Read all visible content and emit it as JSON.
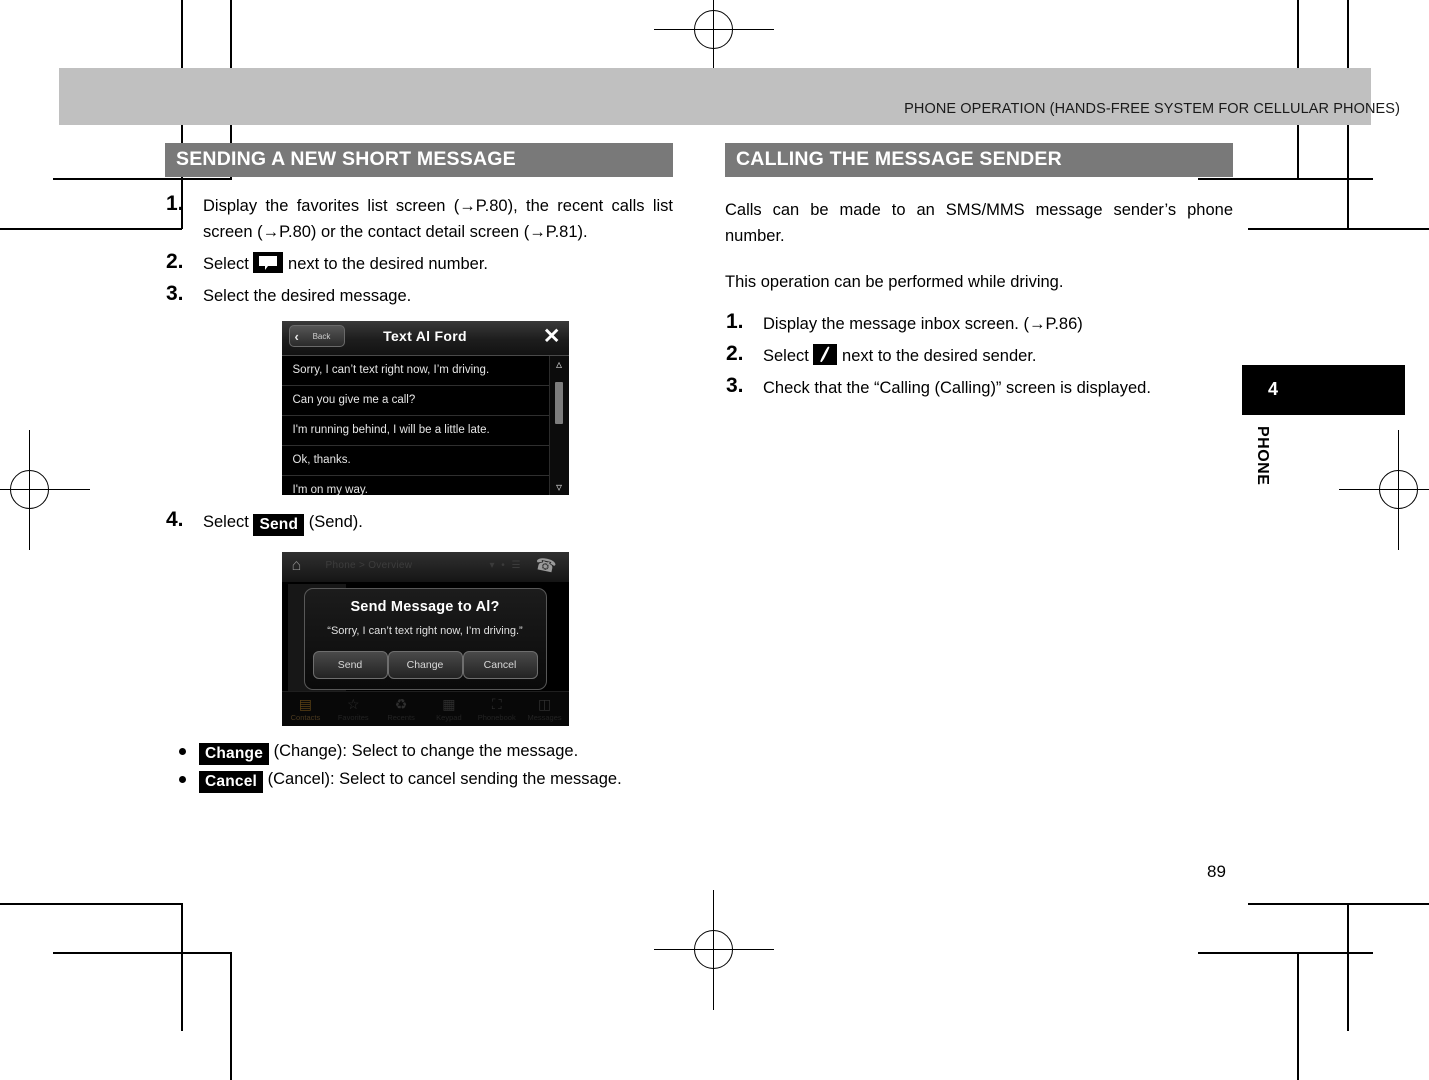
{
  "header": {
    "running_title": "PHONE OPERATION (HANDS-FREE SYSTEM FOR CELLULAR PHONES)"
  },
  "thumb_tab": {
    "chapter_number": "4",
    "chapter_label": "PHONE"
  },
  "page_number": "89",
  "left_column": {
    "section_title": "SENDING A NEW SHORT MESSAGE",
    "steps": [
      {
        "num": "1.",
        "text": "Display the favorites list screen (→P.80), the recent calls list screen (→P.80) or the contact detail screen (→P.81)."
      },
      {
        "num": "2.",
        "text_before": "Select",
        "icon": "message-bubble-icon",
        "text_after": "next to the desired number."
      },
      {
        "num": "3.",
        "text": "Select the desired message."
      },
      {
        "num": "4.",
        "text_before": "Select",
        "keycap": "Send",
        "text_after": "(Send)."
      }
    ],
    "message_list_screenshot": {
      "back_label": "Back",
      "title": "Text Al Ford",
      "close_icon": "close-icon",
      "messages": [
        "Sorry, I can’t text right now, I’m driving.",
        "Can you give me a call?",
        "I'm running behind, I will be a little late.",
        "Ok, thanks.",
        "I'm on my way."
      ],
      "scroll_up_icon": "chevron-up-icon",
      "scroll_down_icon": "chevron-down-icon"
    },
    "dialog_screenshot": {
      "home_icon": "home-icon",
      "breadcrumb": "Phone > Overview",
      "status_icons": "wifi-bluetooth-signal-icons",
      "handset_icon": "phone-handset-icon",
      "question": "Send Message to Al?",
      "body": "“Sorry, I can’t text right now, I’m driving.”",
      "buttons": [
        "Send",
        "Change",
        "Cancel"
      ],
      "tabs": [
        {
          "icon": "contacts-icon",
          "label": "Contacts"
        },
        {
          "icon": "star-icon",
          "label": "Favorites"
        },
        {
          "icon": "recents-icon",
          "label": "Recents"
        },
        {
          "icon": "keypad-icon",
          "label": "Keypad"
        },
        {
          "icon": "phonebook-icon",
          "label": "Phonebook"
        },
        {
          "icon": "messages-icon",
          "label": "Messages"
        }
      ]
    },
    "bullets": [
      {
        "keycap": "Change",
        "text": "(Change): Select to change the message."
      },
      {
        "keycap": "Cancel",
        "text": "(Cancel): Select to cancel sending the message."
      }
    ]
  },
  "right_column": {
    "section_title": "CALLING THE MESSAGE SENDER",
    "paragraphs": [
      "Calls can be made to an SMS/MMS message sender’s phone number.",
      "This operation can be performed while driving."
    ],
    "steps": [
      {
        "num": "1.",
        "text": "Display the message inbox screen. (→P.86)"
      },
      {
        "num": "2.",
        "text_before": "Select",
        "icon": "phone-handset-icon",
        "text_after": "next to the desired sender."
      },
      {
        "num": "3.",
        "text": "Check that the “Calling (Calling)” screen is displayed."
      }
    ]
  }
}
